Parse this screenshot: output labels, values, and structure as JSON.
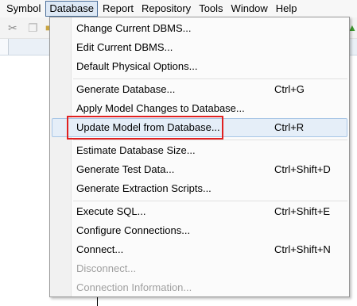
{
  "menubar": {
    "items": [
      "Symbol",
      "Database",
      "Report",
      "Repository",
      "Tools",
      "Window",
      "Help"
    ],
    "active_item": "Database"
  },
  "toolbar": {
    "icons": [
      "cut-icon",
      "copy-icon",
      "paste-icon"
    ]
  },
  "database_menu": {
    "groups": [
      [
        {
          "label": "Change Current DBMS...",
          "shortcut": "",
          "enabled": true
        },
        {
          "label": "Edit Current DBMS...",
          "shortcut": "",
          "enabled": true
        },
        {
          "label": "Default Physical Options...",
          "shortcut": "",
          "enabled": true
        }
      ],
      [
        {
          "label": "Generate Database...",
          "shortcut": "Ctrl+G",
          "enabled": true
        },
        {
          "label": "Apply Model Changes to Database...",
          "shortcut": "",
          "enabled": true
        },
        {
          "label": "Update Model from Database...",
          "shortcut": "Ctrl+R",
          "enabled": true,
          "highlighted": true,
          "annotated": true
        }
      ],
      [
        {
          "label": "Estimate Database Size...",
          "shortcut": "",
          "enabled": true
        },
        {
          "label": "Generate Test Data...",
          "shortcut": "Ctrl+Shift+D",
          "enabled": true
        },
        {
          "label": "Generate Extraction Scripts...",
          "shortcut": "",
          "enabled": true
        }
      ],
      [
        {
          "label": "Execute SQL...",
          "shortcut": "Ctrl+Shift+E",
          "enabled": true
        },
        {
          "label": "Configure Connections...",
          "shortcut": "",
          "enabled": true
        },
        {
          "label": "Connect...",
          "shortcut": "Ctrl+Shift+N",
          "enabled": true
        },
        {
          "label": "Disconnect...",
          "shortcut": "",
          "enabled": false
        },
        {
          "label": "Connection Information...",
          "shortcut": "",
          "enabled": false
        }
      ]
    ]
  },
  "colors": {
    "highlight_bg": "#e5eef8",
    "highlight_border": "#a8c6e6",
    "annotation": "#e02020",
    "disabled_text": "#a0a0a0"
  }
}
